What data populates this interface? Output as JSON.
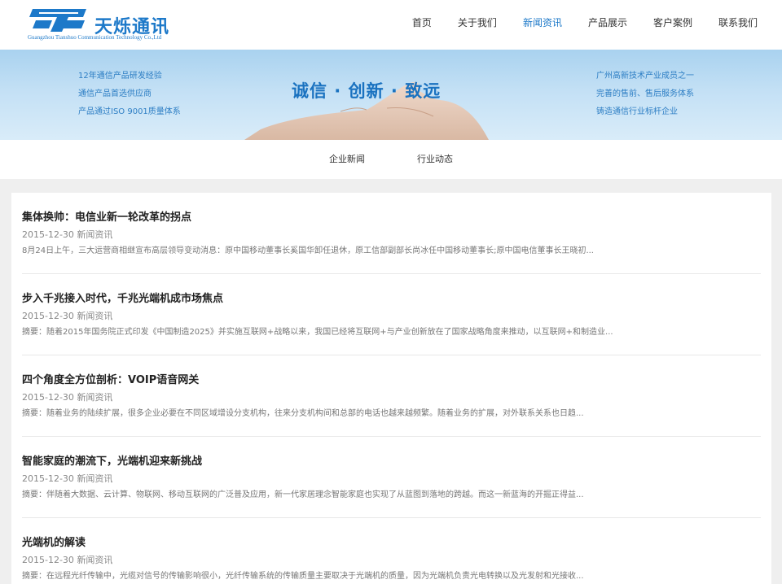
{
  "brand": {
    "name_cn": "天烁通讯",
    "name_en": "Guangzhou Tianshuo Communication Technology Co.,Ltd",
    "color": "#1d79c9"
  },
  "nav": {
    "items": [
      {
        "label": "首页"
      },
      {
        "label": "关于我们"
      },
      {
        "label": "新闻资讯",
        "active": true
      },
      {
        "label": "产品展示"
      },
      {
        "label": "客户案例"
      },
      {
        "label": "联系我们"
      }
    ]
  },
  "banner": {
    "left_lines": [
      "12年通信产品研发经验",
      "通信产品首选供应商",
      "产品通过ISO 9001质量体系"
    ],
    "slogan": "诚信 · 创新 · 致远",
    "right_lines": [
      "广州高新技术产业成员之一",
      "完善的售前、售后服务体系",
      "铸造通信行业标杆企业"
    ]
  },
  "subnav": {
    "items": [
      {
        "label": "企业新闻"
      },
      {
        "label": "行业动态"
      }
    ]
  },
  "articles": [
    {
      "title": "集体换帅：电信业新一轮改革的拐点",
      "date": "2015-12-30",
      "category": "新闻资讯",
      "summary": "8月24日上午，三大运营商相继宣布高层领导变动消息：原中国移动董事长奚国华卸任退休，原工信部副部长尚冰任中国移动董事长;原中国电信董事长王晓初..."
    },
    {
      "title": "步入千兆接入时代，千兆光端机成市场焦点",
      "date": "2015-12-30",
      "category": "新闻资讯",
      "summary": "摘要：随着2015年国务院正式印发《中国制造2025》并实施互联网+战略以来，我国已经将互联网+与产业创新放在了国家战略角度来推动，以互联网+和制造业..."
    },
    {
      "title": "四个角度全方位剖析：VOIP语音网关",
      "date": "2015-12-30",
      "category": "新闻资讯",
      "summary": "摘要：随着业务的陆续扩展，很多企业必要在不同区域增设分支机构，往来分支机构间和总部的电话也越来越频繁。随着业务的扩展，对外联系关系也日趋..."
    },
    {
      "title": "智能家庭的潮流下，光端机迎来新挑战",
      "date": "2015-12-30",
      "category": "新闻资讯",
      "summary": "摘要：伴随着大数据、云计算、物联网、移动互联网的广泛普及应用，新一代家居理念智能家庭也实现了从蓝图到落地的跨越。而这一新蓝海的开掘正得益..."
    },
    {
      "title": "光端机的解读",
      "date": "2015-12-30",
      "category": "新闻资讯",
      "summary": "摘要：在远程光纤传输中，光缆对信号的传输影响很小，光纤传输系统的传输质量主要取决于光端机的质量，因为光端机负责光电转换以及光发射和光接收..."
    }
  ]
}
